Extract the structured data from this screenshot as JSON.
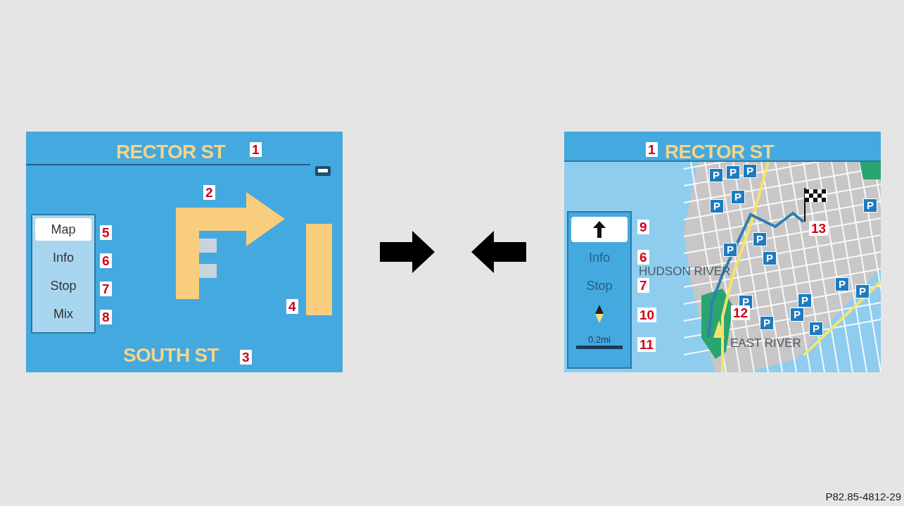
{
  "left_screen": {
    "street_top": {
      "text": "RECTOR ST",
      "callout": "1"
    },
    "maneuver_callout": "2",
    "distance_bar_callout": "4",
    "menu": [
      {
        "label": "Map",
        "selected": true,
        "callout": "5"
      },
      {
        "label": "Info",
        "selected": false,
        "callout": "6"
      },
      {
        "label": "Stop",
        "selected": false,
        "callout": "7"
      },
      {
        "label": "Mix",
        "selected": false,
        "callout": "8"
      }
    ],
    "street_bottom": {
      "text": "SOUTH ST",
      "callout": "3"
    }
  },
  "right_screen": {
    "street_top": {
      "text": "RECTOR ST",
      "callout": "1"
    },
    "menu": [
      {
        "kind": "arrow",
        "selected": true,
        "callout": "9"
      },
      {
        "kind": "text",
        "label": "Info",
        "selected": false,
        "callout": "6"
      },
      {
        "kind": "text",
        "label": "Stop",
        "selected": false,
        "callout": "7"
      },
      {
        "kind": "compass",
        "selected": false,
        "callout": "10"
      },
      {
        "kind": "scale",
        "label": "0.2mi",
        "selected": false,
        "callout": "11"
      }
    ],
    "map": {
      "labels": [
        "HUDSON RIVER",
        "EAST RIVER"
      ],
      "parking_signs": [
        "P",
        "P",
        "P",
        "P",
        "P",
        "P",
        "P",
        "P",
        "P",
        "P",
        "P",
        "P",
        "P",
        "P",
        "P",
        "P"
      ],
      "position_callout": "12",
      "destination_callout": "13"
    }
  },
  "figure_code": "P82.85-4812-29"
}
